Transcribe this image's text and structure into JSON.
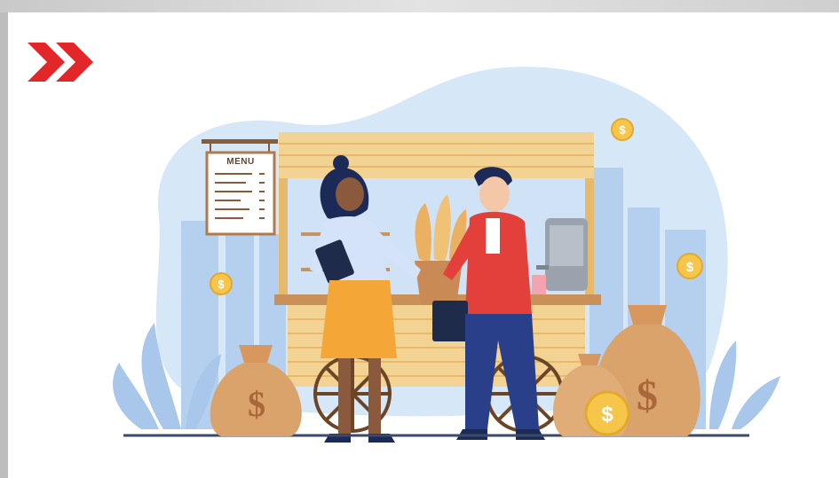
{
  "illustration": {
    "menu_board_title": "MENU",
    "currency_symbol": "$"
  },
  "colors": {
    "brand_red": "#e3262a",
    "sky_blue": "#c9dff3",
    "city_blue": "#a9c9ea",
    "stall_wood": "#f1cc8a",
    "bag_tan": "#dba36c",
    "coin_gold": "#f6c64a"
  },
  "icons": [
    "double-chevron-right-icon",
    "dollar-coin-icon",
    "money-bag-icon"
  ]
}
